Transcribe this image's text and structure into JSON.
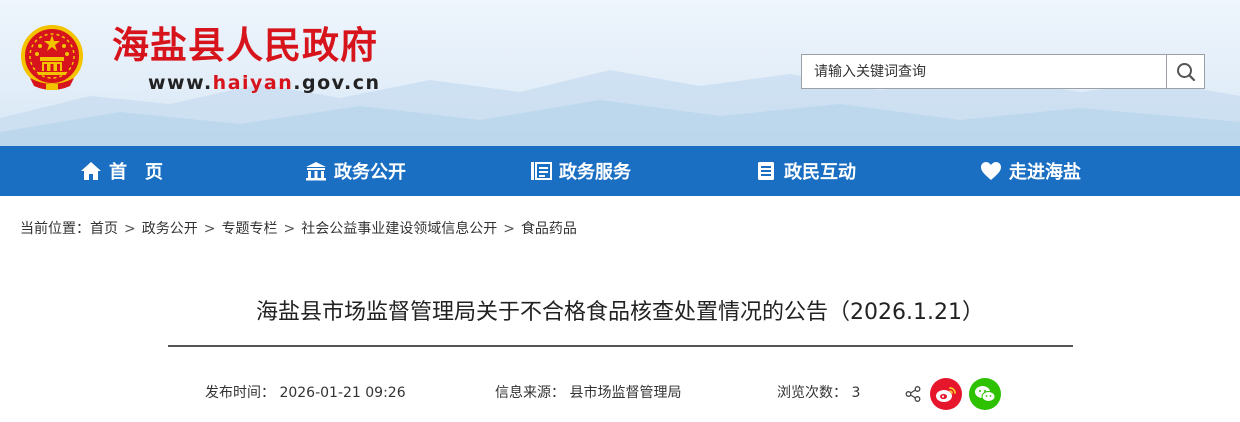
{
  "header": {
    "site_title": "海盐县人民政府",
    "url_prefix": "www.",
    "url_highlight": "haiyan",
    "url_suffix": ".gov.cn"
  },
  "search": {
    "placeholder": "请输入关键词查询"
  },
  "nav": {
    "items": [
      {
        "label": "首　页",
        "icon": "home-icon"
      },
      {
        "label": "政务公开",
        "icon": "government-building-icon"
      },
      {
        "label": "政务服务",
        "icon": "service-list-icon"
      },
      {
        "label": "政民互动",
        "icon": "document-icon"
      },
      {
        "label": "走进海盐",
        "icon": "heart-icon"
      }
    ]
  },
  "breadcrumb": {
    "prefix": "当前位置：",
    "items": [
      "首页",
      "政务公开",
      "专题专栏",
      "社会公益事业建设领域信息公开",
      "食品药品"
    ],
    "separator": ">"
  },
  "article": {
    "title": "海盐县市场监督管理局关于不合格食品核查处置情况的公告（2026.1.21）",
    "publish_label": "发布时间：",
    "publish_time": "2026-01-21 09:26",
    "source_label": "信息来源：",
    "source": "县市场监督管理局",
    "views_label": "浏览次数：",
    "views": "3"
  },
  "colors": {
    "brand_red": "#d7141b",
    "nav_blue": "#1b6fc2",
    "weibo_red": "#e6162d",
    "wechat_green": "#2dc100"
  }
}
